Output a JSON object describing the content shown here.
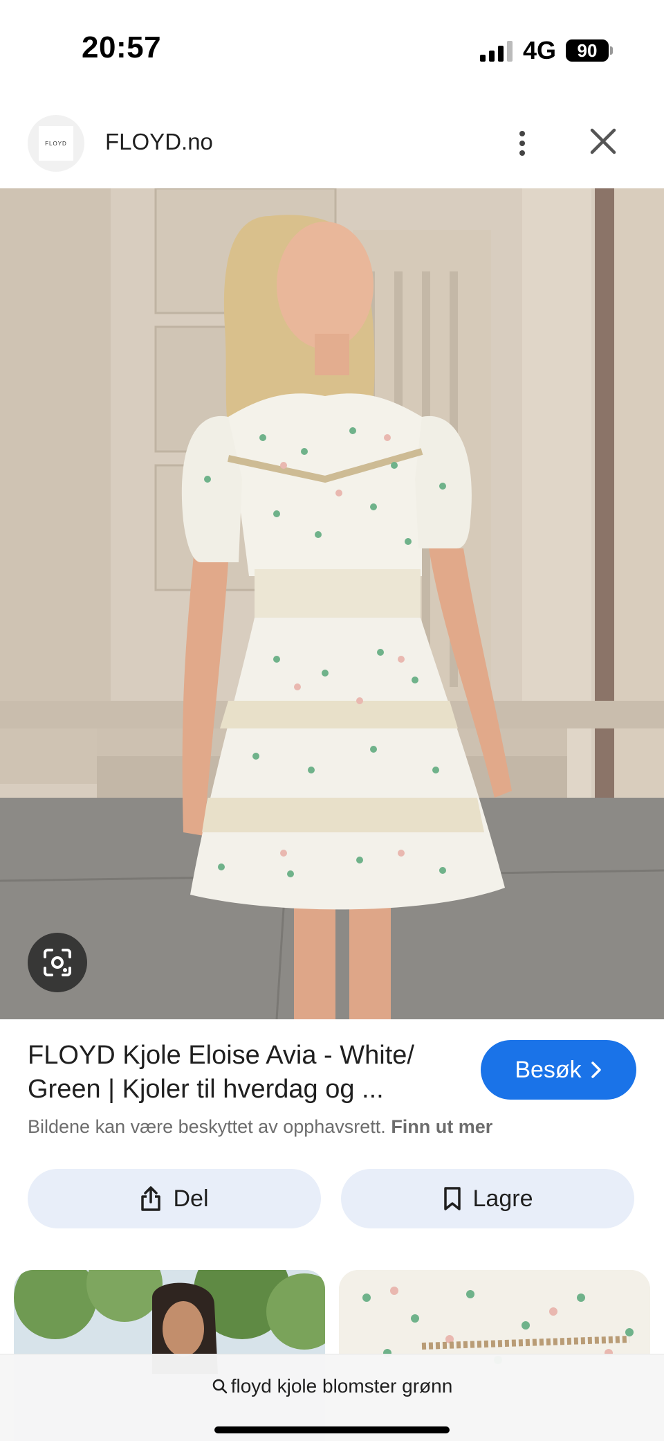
{
  "status_bar": {
    "time": "20:57",
    "network": "4G",
    "battery": "90"
  },
  "site": {
    "logo_text": "FLOYD",
    "name": "FLOYD.no"
  },
  "hero": {
    "description_icon": "google-lens-icon"
  },
  "result": {
    "title": "FLOYD Kjole Eloise Avia - White/ Green | Kjoler til hverdag og ...",
    "visit_label": "Besøk",
    "copyright_text": "Bildene kan være beskyttet av opphavsrett.",
    "learn_more_label": "Finn ut mer"
  },
  "actions": {
    "share_label": "Del",
    "save_label": "Lagre"
  },
  "search": {
    "query": "floyd kjole blomster grønn"
  },
  "colors": {
    "accent": "#1a73e8",
    "action_bg": "#e8eef9"
  }
}
